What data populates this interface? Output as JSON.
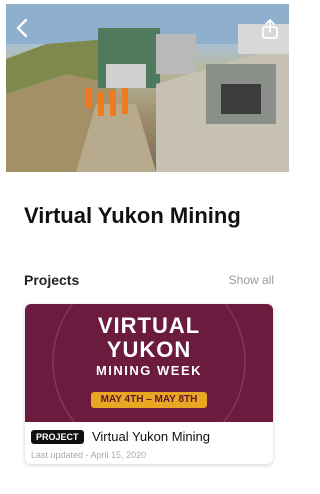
{
  "header": {
    "back_icon": "chevron-left-icon",
    "share_icon": "share-icon"
  },
  "page": {
    "title": "Virtual Yukon Mining"
  },
  "projects_section": {
    "title": "Projects",
    "show_all": "Show all"
  },
  "project_card": {
    "banner": {
      "line1": "VIRTUAL",
      "line2": "YUKON",
      "line3": "MINING WEEK",
      "dates": "MAY 4TH – MAY 8TH"
    },
    "badge": "PROJECT",
    "title": "Virtual Yukon Mining",
    "last_updated": "Last updated - April 15, 2020"
  },
  "colors": {
    "banner_background": "#6b1b3e",
    "banner_accent": "#e9a623"
  }
}
